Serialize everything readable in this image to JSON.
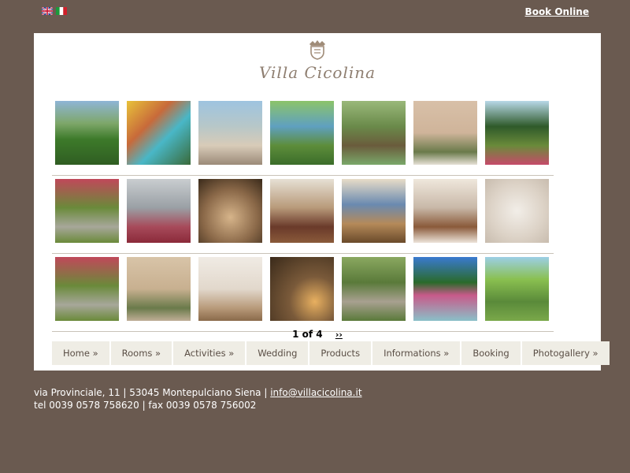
{
  "topbar": {
    "flags": [
      {
        "icon": "uk-flag-icon"
      },
      {
        "icon": "italy-flag-icon"
      }
    ],
    "book_online": "Book Online"
  },
  "brand": {
    "name": "Villa Cicolina",
    "crest_icon": "villa-crest-icon"
  },
  "gallery": {
    "rows": [
      [
        "garden-lounge",
        "pool-with-flowers",
        "terrace-daybed",
        "olive-view",
        "olive-tree",
        "villa-facade",
        "cypress-chapel"
      ],
      [
        "flowered-courtyard",
        "hills-with-flowers",
        "stone-cellar",
        "music-room",
        "dining-room",
        "kitchen-fireplace",
        "stone-relief"
      ],
      [
        "flowered-courtyard",
        "villa-entrance",
        "bedroom",
        "tavern-lantern",
        "garden-path",
        "fountain",
        "olive-view"
      ]
    ]
  },
  "pager": {
    "label": "1 of 4",
    "next": "››"
  },
  "nav": {
    "items": [
      "Home »",
      "Rooms »",
      "Activities »",
      "Wedding",
      "Products",
      "Informations »",
      "Booking",
      "Photogallery »"
    ]
  },
  "footer": {
    "address": "via Provinciale, 11 | 53045 Montepulciano Siena | ",
    "email": "info@villacicolina.it",
    "contacts": "tel 0039 0578 758620 | fax 0039 0578 756002"
  },
  "colors": {
    "background": "#6a5a50",
    "panel": "#ffffff",
    "nav_background": "#efede5",
    "brand": "#8e7e70"
  }
}
